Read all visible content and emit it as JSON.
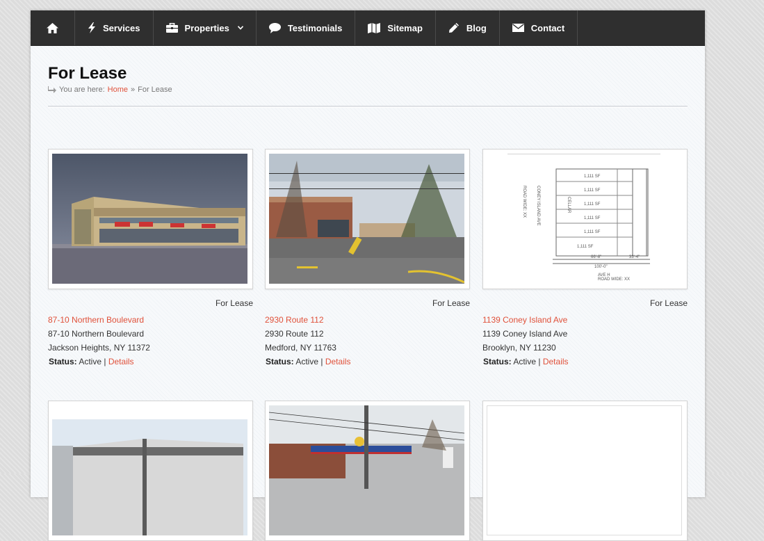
{
  "nav": {
    "items": [
      {
        "label": "",
        "icon": "home-icon"
      },
      {
        "label": "Services",
        "icon": "bolt-icon"
      },
      {
        "label": "Properties",
        "icon": "briefcase-icon"
      },
      {
        "label": "Testimonials",
        "icon": "speech-bubble-icon"
      },
      {
        "label": "Sitemap",
        "icon": "map-icon"
      },
      {
        "label": "Blog",
        "icon": "pencil-icon"
      },
      {
        "label": "Contact",
        "icon": "envelope-icon"
      }
    ]
  },
  "page": {
    "title": "For Lease",
    "breadcrumb_prefix": "You are here:",
    "breadcrumb_home": "Home",
    "breadcrumb_sep": "»",
    "breadcrumb_current": "For Lease"
  },
  "listings": [
    {
      "type": "For Lease",
      "title": "87-10 Northern Boulevard",
      "address": "87-10 Northern Boulevard",
      "city": "Jackson Heights, NY 11372",
      "status_label": "Status:",
      "status": "Active",
      "sep": "|",
      "details": "Details"
    },
    {
      "type": "For Lease",
      "title": "2930 Route 112",
      "address": "2930 Route 112",
      "city": "Medford, NY 11763",
      "status_label": "Status:",
      "status": "Active",
      "sep": "|",
      "details": "Details"
    },
    {
      "type": "For Lease",
      "title": "1139 Coney Island Ave",
      "address": "1139 Coney Island Ave",
      "city": "Brooklyn, NY 11230",
      "status_label": "Status:",
      "status": "Active",
      "sep": "|",
      "details": "Details"
    }
  ],
  "floorplan": {
    "labels": [
      "1,111 SF",
      "1,111 SF",
      "1,111 SF",
      "1,111 SF",
      "1,111 SF",
      "1,111 SF"
    ],
    "cellar": "CELLAR",
    "dim1": "66'-8\"",
    "dim2": "33'-4\"",
    "dim3": "100'-0\"",
    "street1": "CONEY ISLAND AVE",
    "road1": "ROAD WIDE: XX",
    "street2": "AVE H",
    "road2": "ROAD WIDE: XX"
  },
  "colors": {
    "accent": "#e0513a",
    "nav": "#2f2f2f"
  }
}
